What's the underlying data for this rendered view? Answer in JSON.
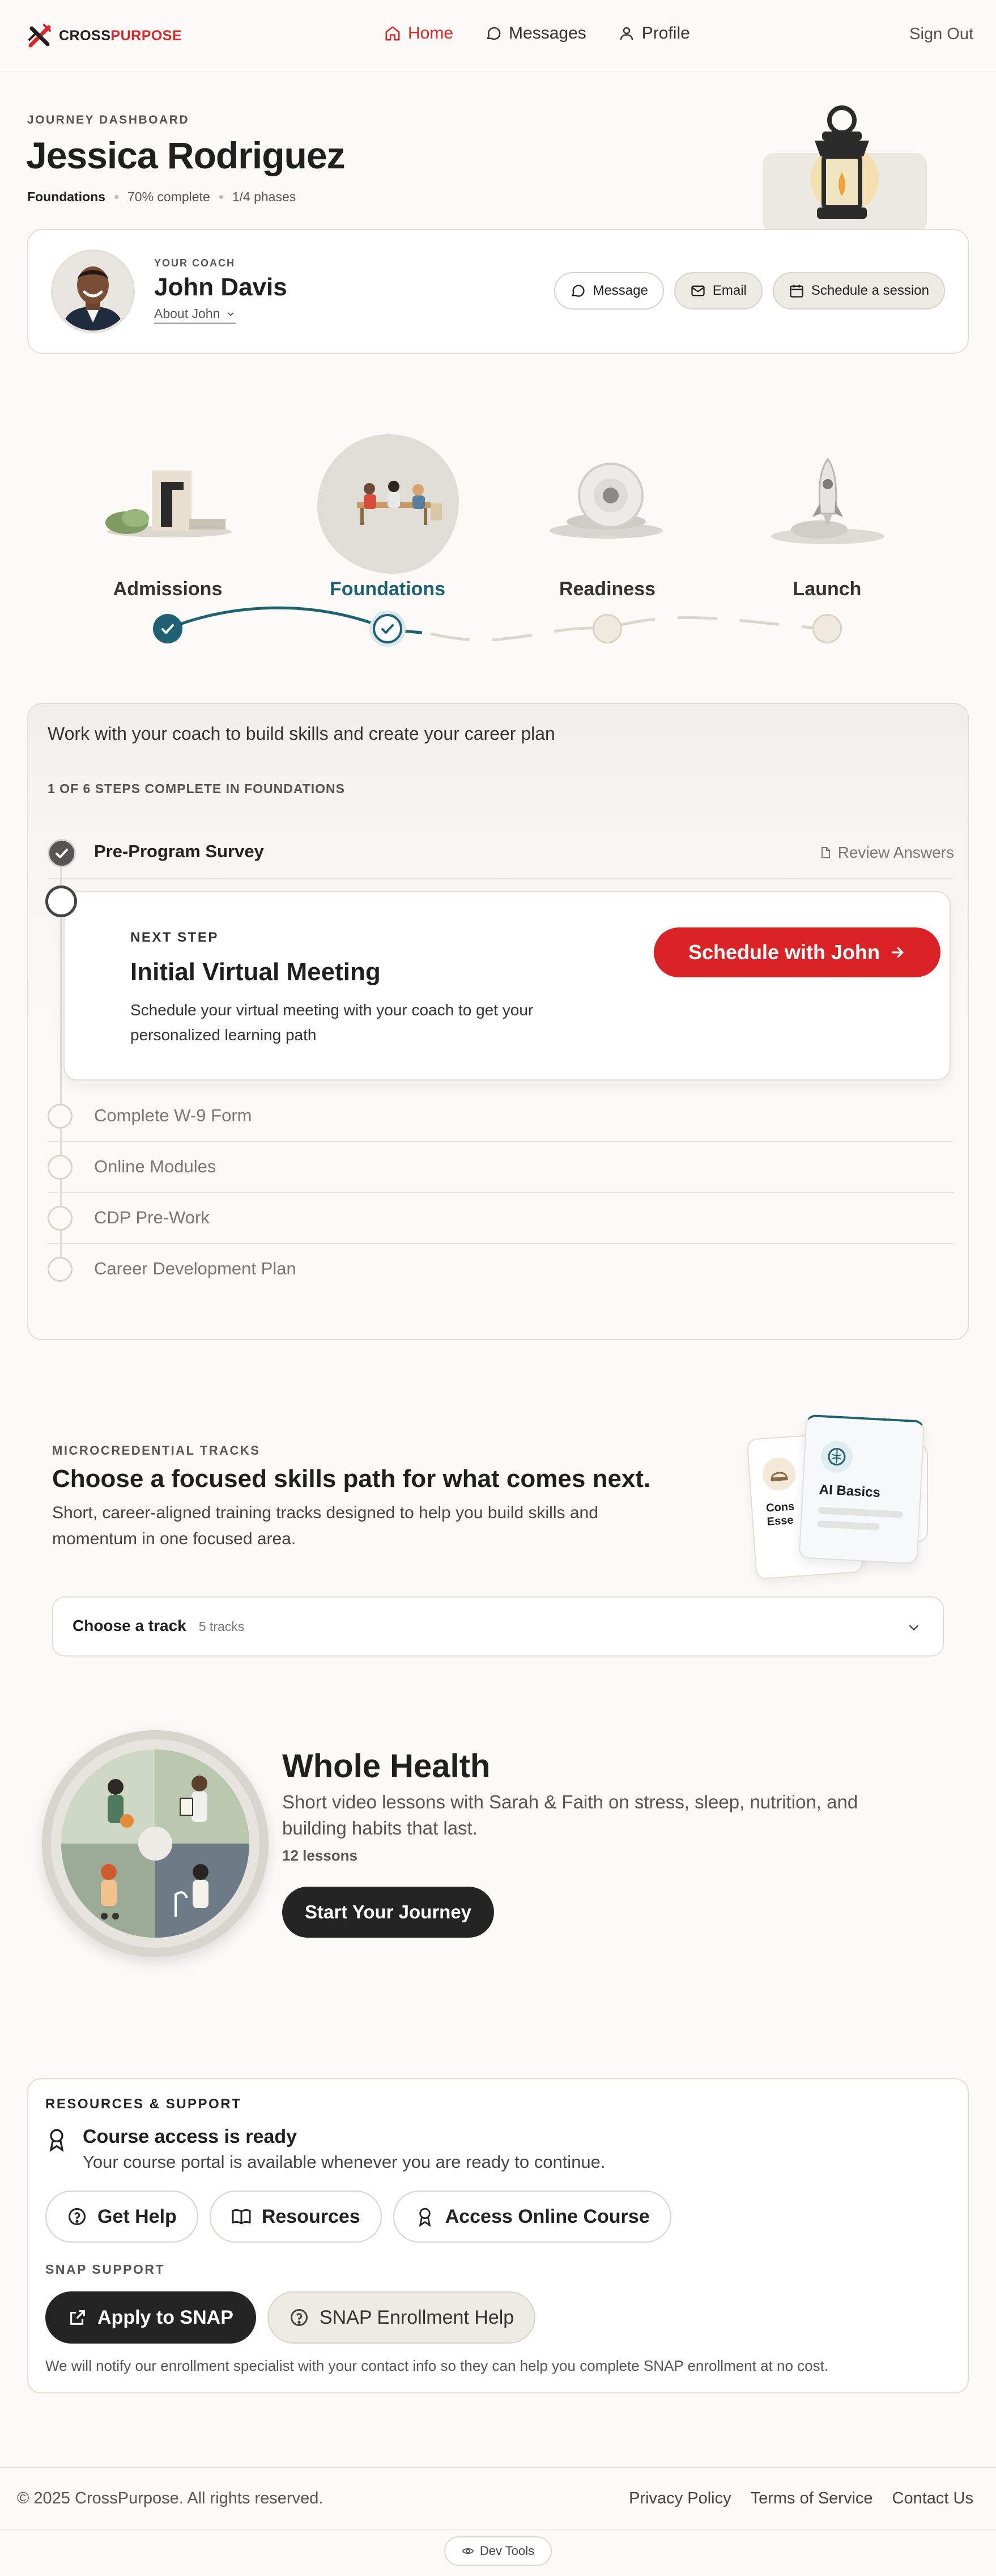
{
  "brand": {
    "name_part1": "CROSS",
    "name_part2": "PURPOSE",
    "red": "#d9262b"
  },
  "nav": {
    "items": [
      {
        "label": "Home",
        "icon": "home-icon",
        "active": true
      },
      {
        "label": "Messages",
        "icon": "chat-bubble-icon",
        "active": false
      },
      {
        "label": "Profile",
        "icon": "person-icon",
        "active": false
      }
    ],
    "sign_out": "Sign Out"
  },
  "dashboard": {
    "eyebrow": "JOURNEY DASHBOARD",
    "name": "Jessica Rodriguez",
    "phase": "Foundations",
    "progress_text": "70% complete",
    "progress": 0.7,
    "phases_text": "1/4 phases"
  },
  "coach": {
    "eyebrow": "YOUR COACH",
    "name": "John Davis",
    "about": "About John",
    "buttons": {
      "message": "Message",
      "email": "Email",
      "schedule": "Schedule a session"
    }
  },
  "journey": {
    "phases": [
      {
        "label": "Admissions",
        "state": "complete"
      },
      {
        "label": "Foundations",
        "state": "current"
      },
      {
        "label": "Readiness",
        "state": "upcoming"
      },
      {
        "label": "Launch",
        "state": "upcoming"
      }
    ],
    "accent": "#1f6072"
  },
  "steps": {
    "intro": "Work with your coach to build skills and create your career plan",
    "count_label": "1 OF 6 STEPS COMPLETE IN FOUNDATIONS",
    "completed": {
      "label": "Pre-Program Survey",
      "action": "Review Answers"
    },
    "next": {
      "eyebrow": "NEXT STEP",
      "title": "Initial Virtual Meeting",
      "description": "Schedule your virtual meeting with your coach to get your personalized learning path",
      "button": "Schedule with John"
    },
    "upcoming": [
      "Complete W-9 Form",
      "Online Modules",
      "CDP Pre-Work",
      "Career Development Plan"
    ]
  },
  "tracks": {
    "eyebrow": "MICROCREDENTIAL TRACKS",
    "title": "Choose a focused skills path for what comes next.",
    "description": "Short, career-aligned training tracks designed to help you build skills and momentum in one focused area.",
    "card_back_title": "Cons Esse",
    "card_front_title": "AI Basics",
    "select_label": "Choose a track",
    "select_count": "5 tracks"
  },
  "featured": {
    "title": "Whole Health",
    "description": "Short video lessons with Sarah & Faith on stress, sleep, nutrition, and building habits that last.",
    "lessons": "12 lessons",
    "button": "Start Your Journey"
  },
  "resources": {
    "eyebrow": "RESOURCES & SUPPORT",
    "access_title": "Course access is ready",
    "access_sub": "Your course portal is available whenever you are ready to continue.",
    "buttons": {
      "help": "Get Help",
      "resources": "Resources",
      "course": "Access Online Course"
    },
    "snap_eyebrow": "SNAP SUPPORT",
    "snap_apply": "Apply to SNAP",
    "snap_help": "SNAP Enrollment Help",
    "snap_note": "We will notify our enrollment specialist with your contact info so they can help you complete SNAP enrollment at no cost."
  },
  "footer": {
    "copyright": "© 2025 CrossPurpose. All rights reserved.",
    "links": [
      "Privacy Policy",
      "Terms of Service",
      "Contact Us"
    ],
    "dev_tools": "Dev Tools"
  }
}
